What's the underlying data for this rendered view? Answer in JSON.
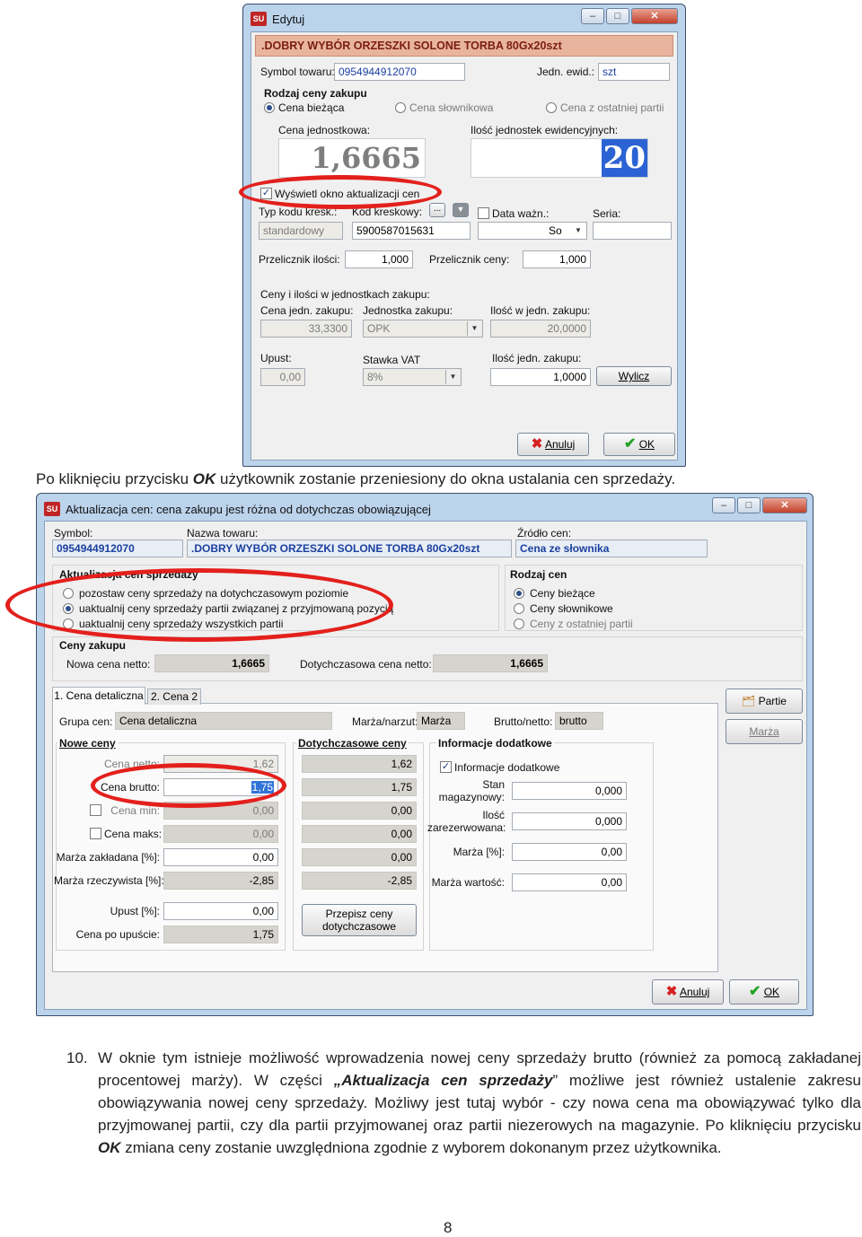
{
  "win1": {
    "title": "Edytuj",
    "product_name": ".DOBRY WYBÓR ORZESZKI SOLONE TORBA 80Gx20szt",
    "symbol_label": "Symbol towaru:",
    "symbol_value": "0954944912070",
    "unit_label": "Jedn. ewid.:",
    "unit_value": "szt",
    "price_type_header": "Rodzaj ceny zakupu",
    "price_options": [
      "Cena bieżąca",
      "Cena słownikowa",
      "Cena z ostatniej partii"
    ],
    "unit_price_label": "Cena jednostkowa:",
    "unit_price_value": "1,6665",
    "qty_label": "Ilość jednostek ewidencyjnych:",
    "qty_value": "20",
    "show_update_label": "Wyświetl okno aktualizacji cen",
    "barcode_type_label": "Typ kodu kresk.:",
    "barcode_type_value": "standardowy",
    "barcode_label": "Kod kreskowy:",
    "barcode_value": "5900587015631",
    "expiry_label": "Data ważn.:",
    "expiry_value": "So",
    "series_label": "Seria:",
    "qty_conv_label": "Przelicznik ilości:",
    "qty_conv_value": "1,000",
    "price_conv_label": "Przelicznik ceny:",
    "price_conv_value": "1,000",
    "purchase_units_header": "Ceny i ilości w jednostkach zakupu:",
    "purchase_price_label": "Cena jedn. zakupu:",
    "purchase_price_value": "33,3300",
    "purchase_unit_label": "Jednostka zakupu:",
    "purchase_unit_value": "OPK",
    "qty_in_unit_label": "Ilość w jedn. zakupu:",
    "qty_in_unit_value": "20,0000",
    "discount_label": "Upust:",
    "discount_value": "0,00",
    "vat_label": "Stawka VAT",
    "vat_value": "8%",
    "purchase_qty_label": "Ilość jedn. zakupu:",
    "purchase_qty_value": "1,0000",
    "calc_btn": "Wylicz",
    "cancel_btn": "Anuluj",
    "ok_btn": "OK"
  },
  "caption_prefix": "Po kliknięciu przycisku ",
  "caption_bold": "OK",
  "caption_suffix": " użytkownik zostanie przeniesiony do okna ustalania cen sprzedaży.",
  "win2": {
    "title": "Aktualizacja cen: cena zakupu jest różna od dotychczas obowiązującej",
    "symbol_label": "Symbol:",
    "symbol_value": "0954944912070",
    "name_label": "Nazwa towaru:",
    "name_value": ".DOBRY WYBÓR ORZESZKI SOLONE TORBA 80Gx20szt",
    "source_label": "Źródło cen:",
    "source_value": "Cena ze słownika",
    "update_header": "Aktualizacja cen sprzedaży",
    "update_options": [
      "pozostaw ceny sprzedaży na dotychczasowym poziomie",
      "uaktualnij ceny sprzedaży partii związanej z przyjmowaną pozycją",
      "uaktualnij ceny sprzedaży wszystkich partii"
    ],
    "price_kind_header": "Rodzaj cen",
    "price_kind_options": [
      "Ceny bieżące",
      "Ceny słownikowe",
      "Ceny z ostatniej partii"
    ],
    "purchase_header": "Ceny zakupu",
    "new_net_label": "Nowa cena netto:",
    "new_net_value": "1,6665",
    "old_net_label": "Dotychczasowa cena netto:",
    "old_net_value": "1,6665",
    "tabs": [
      "1. Cena detaliczna",
      "2. Cena 2"
    ],
    "group_label": "Grupa cen:",
    "group_value": "Cena detaliczna",
    "margin_label": "Marża/narzut:",
    "margin_value": "Marża",
    "gross_label": "Brutto/netto:",
    "gross_value": "brutto",
    "new_prices_header": "Nowe ceny",
    "old_prices_header": "Dotychczasowe ceny",
    "extra_header": "Informacje dodatkowe",
    "rows": [
      {
        "label": "Cena netto:",
        "new": "1,62",
        "old": "1,62"
      },
      {
        "label": "Cena brutto:",
        "new": "1,75",
        "old": "1,75"
      },
      {
        "label": "Cena min:",
        "new": "0,00",
        "old": "0,00"
      },
      {
        "label": "Cena maks:",
        "new": "0,00",
        "old": "0,00"
      },
      {
        "label": "Marża zakładana [%]:",
        "new": "0,00",
        "old": "0,00"
      },
      {
        "label": "Marża rzeczywista [%]:",
        "new": "-2,85",
        "old": "-2,85"
      }
    ],
    "discount_label": "Upust [%]:",
    "discount_value": "0,00",
    "after_discount_label": "Cena po upuście:",
    "after_discount_value": "1,75",
    "copy_btn_line1": "Przepisz ceny",
    "copy_btn_line2": "dotychczasowe",
    "extra_check_label": "Informacje dodatkowe",
    "stock_label1": "Stan",
    "stock_label2": "magazynowy:",
    "stock_value": "0,000",
    "reserved_label1": "Ilość",
    "reserved_label2": "zarezerwowana:",
    "reserved_value": "0,000",
    "margin_pct_label": "Marża [%]:",
    "margin_pct_value": "0,00",
    "margin_val_label": "Marża wartość:",
    "margin_val_value": "0,00",
    "parts_btn": "Partie",
    "margin_btn": "Marża",
    "cancel_btn": "Anuluj",
    "ok_btn": "OK"
  },
  "para": {
    "number": "10.",
    "t1": "W oknie tym istnieje możliwość wprowadzenia nowej ceny sprzedaży brutto (również za pomocą zakładanej procentowej marży). W części ",
    "bold1": "„Aktualizacja cen sprzedaży",
    "t2": "” możliwe jest również ustalenie zakresu obowiązywania nowej ceny sprzedaży. Możliwy jest tutaj wybór - czy nowa cena ma obowiązywać tylko dla przyjmowanej partii, czy dla partii przyjmowanej oraz partii niezerowych na magazynie. Po kliknięciu przycisku ",
    "bold2": "OK",
    "t3": " zmiana ceny zostanie uwzględniona zgodnie z wyborem dokonanym przez użytkownika."
  },
  "page_number": "8",
  "colors": {
    "highlight": "#e3201c",
    "title_bar": "#bcd3ec",
    "accent_blue": "#1a3fa0"
  }
}
